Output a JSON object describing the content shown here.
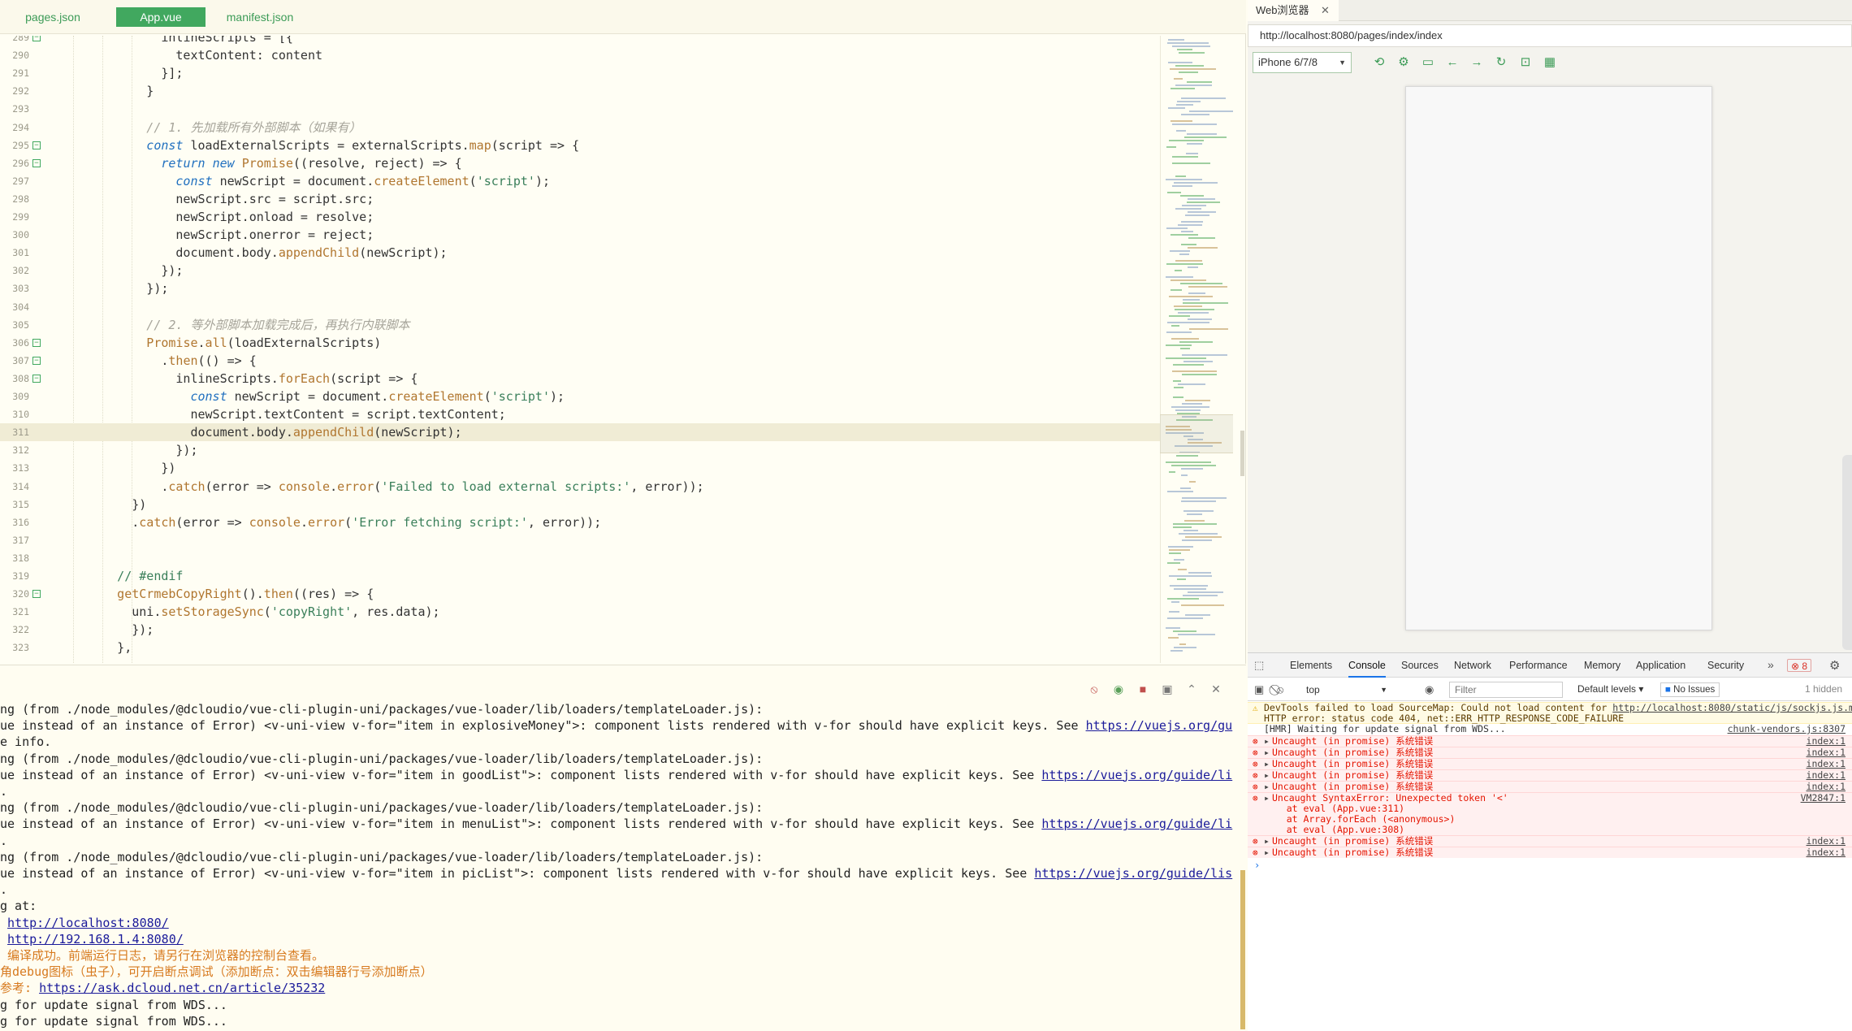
{
  "editor": {
    "tabs": [
      "pages.json",
      "App.vue",
      "manifest.json"
    ],
    "active_tab": 1,
    "lines": [
      {
        "n": "289",
        "fold": true,
        "indent": 12,
        "tokens": [
          [
            "t",
            "inlineScripts = [{"
          ]
        ]
      },
      {
        "n": "290",
        "fold": false,
        "indent": 14,
        "tokens": [
          [
            "t",
            "textContent: content"
          ]
        ]
      },
      {
        "n": "291",
        "fold": false,
        "indent": 12,
        "tokens": [
          [
            "t",
            "}];"
          ]
        ]
      },
      {
        "n": "292",
        "fold": false,
        "indent": 10,
        "tokens": [
          [
            "t",
            "}"
          ]
        ]
      },
      {
        "n": "293",
        "fold": false,
        "indent": 0,
        "tokens": []
      },
      {
        "n": "294",
        "fold": false,
        "indent": 10,
        "tokens": [
          [
            "c",
            "// 1. 先加载所有外部脚本（如果有）"
          ]
        ]
      },
      {
        "n": "295",
        "fold": true,
        "indent": 10,
        "tokens": [
          [
            "k",
            "const"
          ],
          [
            "t",
            " loadExternalScripts = externalScripts."
          ],
          [
            "f",
            "map"
          ],
          [
            "t",
            "(script => {"
          ]
        ]
      },
      {
        "n": "296",
        "fold": true,
        "indent": 12,
        "tokens": [
          [
            "k",
            "return"
          ],
          [
            "t",
            " "
          ],
          [
            "k",
            "new"
          ],
          [
            "t",
            " "
          ],
          [
            "f",
            "Promise"
          ],
          [
            "t",
            "((resolve, reject) => {"
          ]
        ]
      },
      {
        "n": "297",
        "fold": false,
        "indent": 14,
        "tokens": [
          [
            "k",
            "const"
          ],
          [
            "t",
            " newScript = document."
          ],
          [
            "f",
            "createElement"
          ],
          [
            "t",
            "("
          ],
          [
            "s",
            "'script'"
          ],
          [
            "t",
            ");"
          ]
        ]
      },
      {
        "n": "298",
        "fold": false,
        "indent": 14,
        "tokens": [
          [
            "t",
            "newScript.src = script.src;"
          ]
        ]
      },
      {
        "n": "299",
        "fold": false,
        "indent": 14,
        "tokens": [
          [
            "t",
            "newScript.onload = resolve;"
          ]
        ]
      },
      {
        "n": "300",
        "fold": false,
        "indent": 14,
        "tokens": [
          [
            "t",
            "newScript.onerror = reject;"
          ]
        ]
      },
      {
        "n": "301",
        "fold": false,
        "indent": 14,
        "tokens": [
          [
            "t",
            "document.body."
          ],
          [
            "f",
            "appendChild"
          ],
          [
            "t",
            "(newScript);"
          ]
        ]
      },
      {
        "n": "302",
        "fold": false,
        "indent": 12,
        "tokens": [
          [
            "t",
            "});"
          ]
        ]
      },
      {
        "n": "303",
        "fold": false,
        "indent": 10,
        "tokens": [
          [
            "t",
            "});"
          ]
        ]
      },
      {
        "n": "304",
        "fold": false,
        "indent": 0,
        "tokens": []
      },
      {
        "n": "305",
        "fold": false,
        "indent": 10,
        "tokens": [
          [
            "c",
            "// 2. 等外部脚本加载完成后，再执行内联脚本"
          ]
        ]
      },
      {
        "n": "306",
        "fold": true,
        "indent": 10,
        "tokens": [
          [
            "f",
            "Promise"
          ],
          [
            "t",
            "."
          ],
          [
            "f",
            "all"
          ],
          [
            "t",
            "(loadExternalScripts)"
          ]
        ]
      },
      {
        "n": "307",
        "fold": true,
        "indent": 12,
        "tokens": [
          [
            "t",
            "."
          ],
          [
            "f",
            "then"
          ],
          [
            "t",
            "(() => {"
          ]
        ]
      },
      {
        "n": "308",
        "fold": true,
        "indent": 14,
        "tokens": [
          [
            "t",
            "inlineScripts."
          ],
          [
            "f",
            "forEach"
          ],
          [
            "t",
            "(script => {"
          ]
        ]
      },
      {
        "n": "309",
        "fold": false,
        "indent": 16,
        "tokens": [
          [
            "k",
            "const"
          ],
          [
            "t",
            " newScript = document."
          ],
          [
            "f",
            "createElement"
          ],
          [
            "t",
            "("
          ],
          [
            "s",
            "'script'"
          ],
          [
            "t",
            ");"
          ]
        ]
      },
      {
        "n": "310",
        "fold": false,
        "indent": 16,
        "tokens": [
          [
            "t",
            "newScript.textContent = script.textContent;"
          ]
        ]
      },
      {
        "n": "311",
        "fold": false,
        "indent": 16,
        "current": true,
        "tokens": [
          [
            "t",
            "document.body."
          ],
          [
            "f",
            "appendChild"
          ],
          [
            "t",
            "(newScript);"
          ]
        ]
      },
      {
        "n": "312",
        "fold": false,
        "indent": 14,
        "tokens": [
          [
            "t",
            "});"
          ]
        ]
      },
      {
        "n": "313",
        "fold": false,
        "indent": 12,
        "tokens": [
          [
            "t",
            "})"
          ]
        ]
      },
      {
        "n": "314",
        "fold": false,
        "indent": 12,
        "tokens": [
          [
            "t",
            "."
          ],
          [
            "f",
            "catch"
          ],
          [
            "t",
            "(error => "
          ],
          [
            "f",
            "console"
          ],
          [
            "t",
            "."
          ],
          [
            "f",
            "error"
          ],
          [
            "t",
            "("
          ],
          [
            "s",
            "'Failed to load external scripts:'"
          ],
          [
            "t",
            ", error));"
          ]
        ]
      },
      {
        "n": "315",
        "fold": false,
        "indent": 8,
        "tokens": [
          [
            "t",
            "})"
          ]
        ]
      },
      {
        "n": "316",
        "fold": false,
        "indent": 8,
        "tokens": [
          [
            "t",
            "."
          ],
          [
            "f",
            "catch"
          ],
          [
            "t",
            "(error => "
          ],
          [
            "f",
            "console"
          ],
          [
            "t",
            "."
          ],
          [
            "f",
            "error"
          ],
          [
            "t",
            "("
          ],
          [
            "s",
            "'Error fetching script:'"
          ],
          [
            "t",
            ", error));"
          ]
        ]
      },
      {
        "n": "317",
        "fold": false,
        "indent": 0,
        "tokens": []
      },
      {
        "n": "318",
        "fold": false,
        "indent": 0,
        "tokens": []
      },
      {
        "n": "319",
        "fold": false,
        "indent": 6,
        "tokens": [
          [
            "s",
            "// #endif"
          ]
        ]
      },
      {
        "n": "320",
        "fold": true,
        "indent": 6,
        "tokens": [
          [
            "f",
            "getCrmebCopyRight"
          ],
          [
            "t",
            "()."
          ],
          [
            "f",
            "then"
          ],
          [
            "t",
            "((res) => {"
          ]
        ]
      },
      {
        "n": "321",
        "fold": false,
        "indent": 8,
        "tokens": [
          [
            "t",
            "uni."
          ],
          [
            "f",
            "setStorageSync"
          ],
          [
            "t",
            "("
          ],
          [
            "s",
            "'copyRight'"
          ],
          [
            "t",
            ", res.data);"
          ]
        ]
      },
      {
        "n": "322",
        "fold": false,
        "indent": 8,
        "tokens": [
          [
            "t",
            "});"
          ]
        ]
      },
      {
        "n": "323",
        "fold": false,
        "indent": 6,
        "tokens": [
          [
            "t",
            "},"
          ]
        ]
      }
    ]
  },
  "terminal": {
    "lines": [
      {
        "text": "ng (from ./node_modules/@dcloudio/vue-cli-plugin-uni/packages/vue-loader/lib/loaders/templateLoader.js):"
      },
      {
        "text": "ue instead of an instance of Error) <v-uni-view v-for=\"item in explosiveMoney\">: component lists rendered with v-for should have explicit keys. See ",
        "link": "https://vuejs.org/gu"
      },
      {
        "text": "e info."
      },
      {
        "text": "ng (from ./node_modules/@dcloudio/vue-cli-plugin-uni/packages/vue-loader/lib/loaders/templateLoader.js):"
      },
      {
        "text": "ue instead of an instance of Error) <v-uni-view v-for=\"item in goodList\">: component lists rendered with v-for should have explicit keys. See ",
        "link": "https://vuejs.org/guide/li"
      },
      {
        "text": "."
      },
      {
        "text": "ng (from ./node_modules/@dcloudio/vue-cli-plugin-uni/packages/vue-loader/lib/loaders/templateLoader.js):"
      },
      {
        "text": "ue instead of an instance of Error) <v-uni-view v-for=\"item in menuList\">: component lists rendered with v-for should have explicit keys. See ",
        "link": "https://vuejs.org/guide/li"
      },
      {
        "text": "."
      },
      {
        "text": "ng (from ./node_modules/@dcloudio/vue-cli-plugin-uni/packages/vue-loader/lib/loaders/templateLoader.js):"
      },
      {
        "text": "ue instead of an instance of Error) <v-uni-view v-for=\"item in picList\">: component lists rendered with v-for should have explicit keys. See ",
        "link": "https://vuejs.org/guide/lis"
      },
      {
        "text": "."
      },
      {
        "text": "g at:"
      },
      {
        "text": " ",
        "link": "http://localhost:8080/"
      },
      {
        "text": " ",
        "link": "http://192.168.1.4:8080/"
      },
      {
        "text": " 编译成功。前端运行日志，请另行在浏览器的控制台查看。",
        "orange": true
      },
      {
        "text": "角debug图标（虫子），可开启断点调试（添加断点：双击编辑器行号添加断点）",
        "orange": true
      },
      {
        "text": "参考: ",
        "orange": true,
        "link": "https://ask.dcloud.net.cn/article/35232"
      },
      {
        "text": "g for update signal from WDS..."
      },
      {
        "text": "g for update signal from WDS..."
      }
    ]
  },
  "browser": {
    "tab_title": "Web浏览器",
    "close_glyph": "✕",
    "url": "http://localhost:8080/pages/index/index",
    "device": "iPhone 6/7/8"
  },
  "devtools": {
    "tabs": [
      "Elements",
      "Console",
      "Sources",
      "Network",
      "Performance",
      "Memory",
      "Application",
      "Security"
    ],
    "active_tab": 1,
    "more_glyph": "»",
    "error_count": "8",
    "context": "top",
    "filter_placeholder": "Filter",
    "levels": "Default levels ▾",
    "issues": "No Issues",
    "hidden": "1 hidden",
    "messages": [
      {
        "type": "warn",
        "text": "DevTools failed to load SourceMap: Could not load content for ",
        "link": "http://localhost:8080/static/js/sockjs.js.map",
        "text2": ":",
        "line2": "HTTP error: status code 404, net::ERR_HTTP_RESPONSE_CODE_FAILURE",
        "src": ""
      },
      {
        "type": "info",
        "text": "[HMR] Waiting for update signal from WDS...",
        "src": "chunk-vendors.js:8307"
      },
      {
        "type": "err",
        "text": "Uncaught (in promise) 系统错误",
        "src": "index:1"
      },
      {
        "type": "err",
        "text": "Uncaught (in promise) 系统错误",
        "src": "index:1"
      },
      {
        "type": "err",
        "text": "Uncaught (in promise) 系统错误",
        "src": "index:1"
      },
      {
        "type": "err",
        "text": "Uncaught (in promise) 系统错误",
        "src": "index:1"
      },
      {
        "type": "err",
        "text": "Uncaught (in promise) 系统错误",
        "src": "index:1"
      },
      {
        "type": "err",
        "text": "Uncaught SyntaxError: Unexpected token '<'",
        "src": "VM2847:1",
        "stack": [
          "at eval (App.vue:311)",
          "at Array.forEach (<anonymous>)",
          "at eval (App.vue:308)"
        ]
      },
      {
        "type": "err",
        "text": "Uncaught (in promise) 系统错误",
        "src": "index:1"
      },
      {
        "type": "err",
        "text": "Uncaught (in promise) 系统错误",
        "src": "index:1"
      }
    ],
    "prompt": "›"
  }
}
